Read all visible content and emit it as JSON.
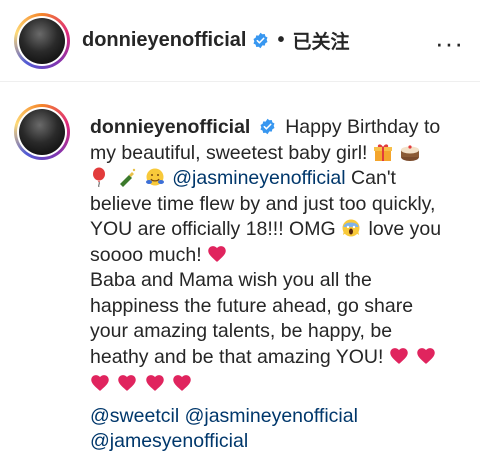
{
  "header": {
    "username": "donnieyenofficial",
    "separator": "•",
    "follow_state": "已关注",
    "more": "···"
  },
  "comment": {
    "username": "donnieyenofficial",
    "lines": [
      "Happy Birthday to",
      "my beautiful, sweetest baby girl!",
      "@jasmineyenofficial",
      "Can't",
      "believe time flew by and just too quickly,",
      "YOU are officially 18!!! OMG",
      "love you",
      "soooo much!",
      "Baba and Mama wish you all the",
      "happiness the future ahead, go share",
      "your amazing talents, be happy, be",
      "heathy and be that amazing YOU!"
    ],
    "tags": [
      "@sweetcil",
      "@jasmineyenofficial",
      "@jamesyenofficial"
    ]
  },
  "colors": {
    "heart": "#e0245e",
    "mention": "#00376b",
    "verified": "#3897f0"
  },
  "icons": [
    "verified-badge-icon",
    "gift-emoji",
    "cake-emoji",
    "balloon-emoji",
    "champagne-emoji",
    "hugging-face-emoji",
    "scream-emoji",
    "red-heart-emoji"
  ]
}
